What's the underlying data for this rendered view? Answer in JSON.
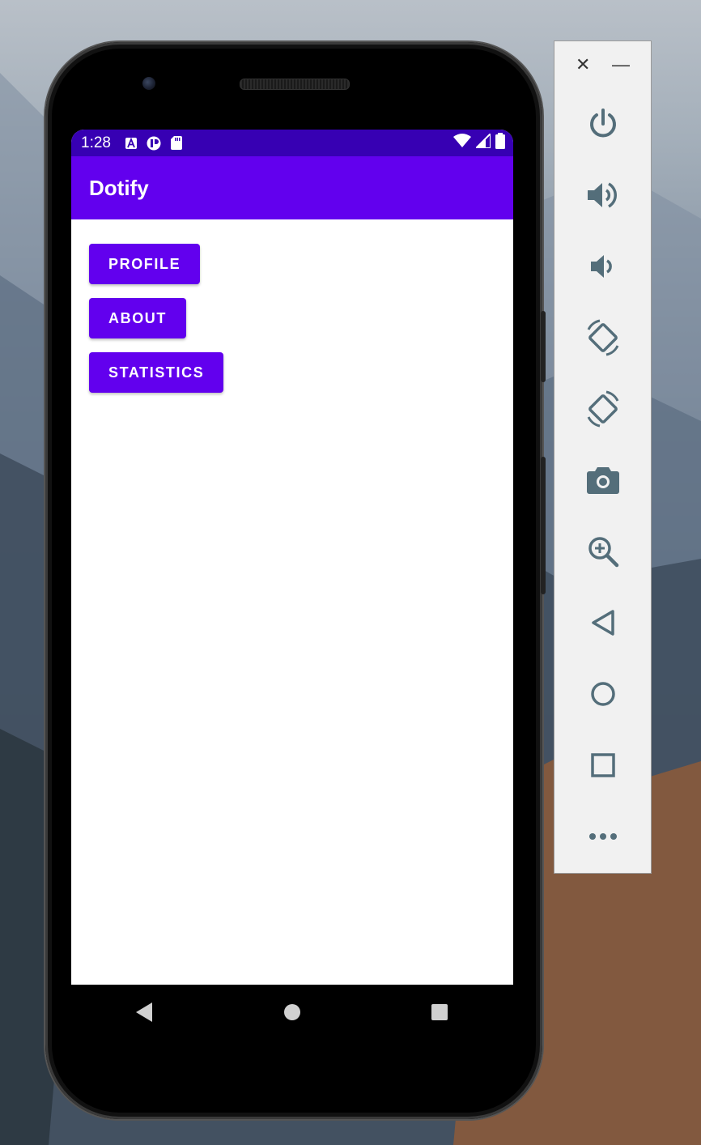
{
  "status_bar": {
    "time": "1:28",
    "notification_icons": [
      "a-icon",
      "sync-icon",
      "sd-card-icon"
    ],
    "right_icons": [
      "wifi-icon",
      "signal-icon",
      "battery-icon"
    ]
  },
  "app_bar": {
    "title": "Dotify"
  },
  "buttons": {
    "profile": "PROFILE",
    "about": "ABOUT",
    "statistics": "STATISTICS"
  },
  "nav_bar": [
    "back-icon",
    "home-icon",
    "recents-icon"
  ],
  "emulator_toolbar": {
    "close": "✕",
    "minimize": "—",
    "items": [
      "power",
      "volume-up",
      "volume-down",
      "rotate-left",
      "rotate-right",
      "screenshot",
      "zoom",
      "back",
      "home",
      "overview",
      "more"
    ]
  },
  "colors": {
    "primary": "#6200ee",
    "primary_dark": "#3700b3",
    "toolbar_icon": "#546e7a"
  }
}
